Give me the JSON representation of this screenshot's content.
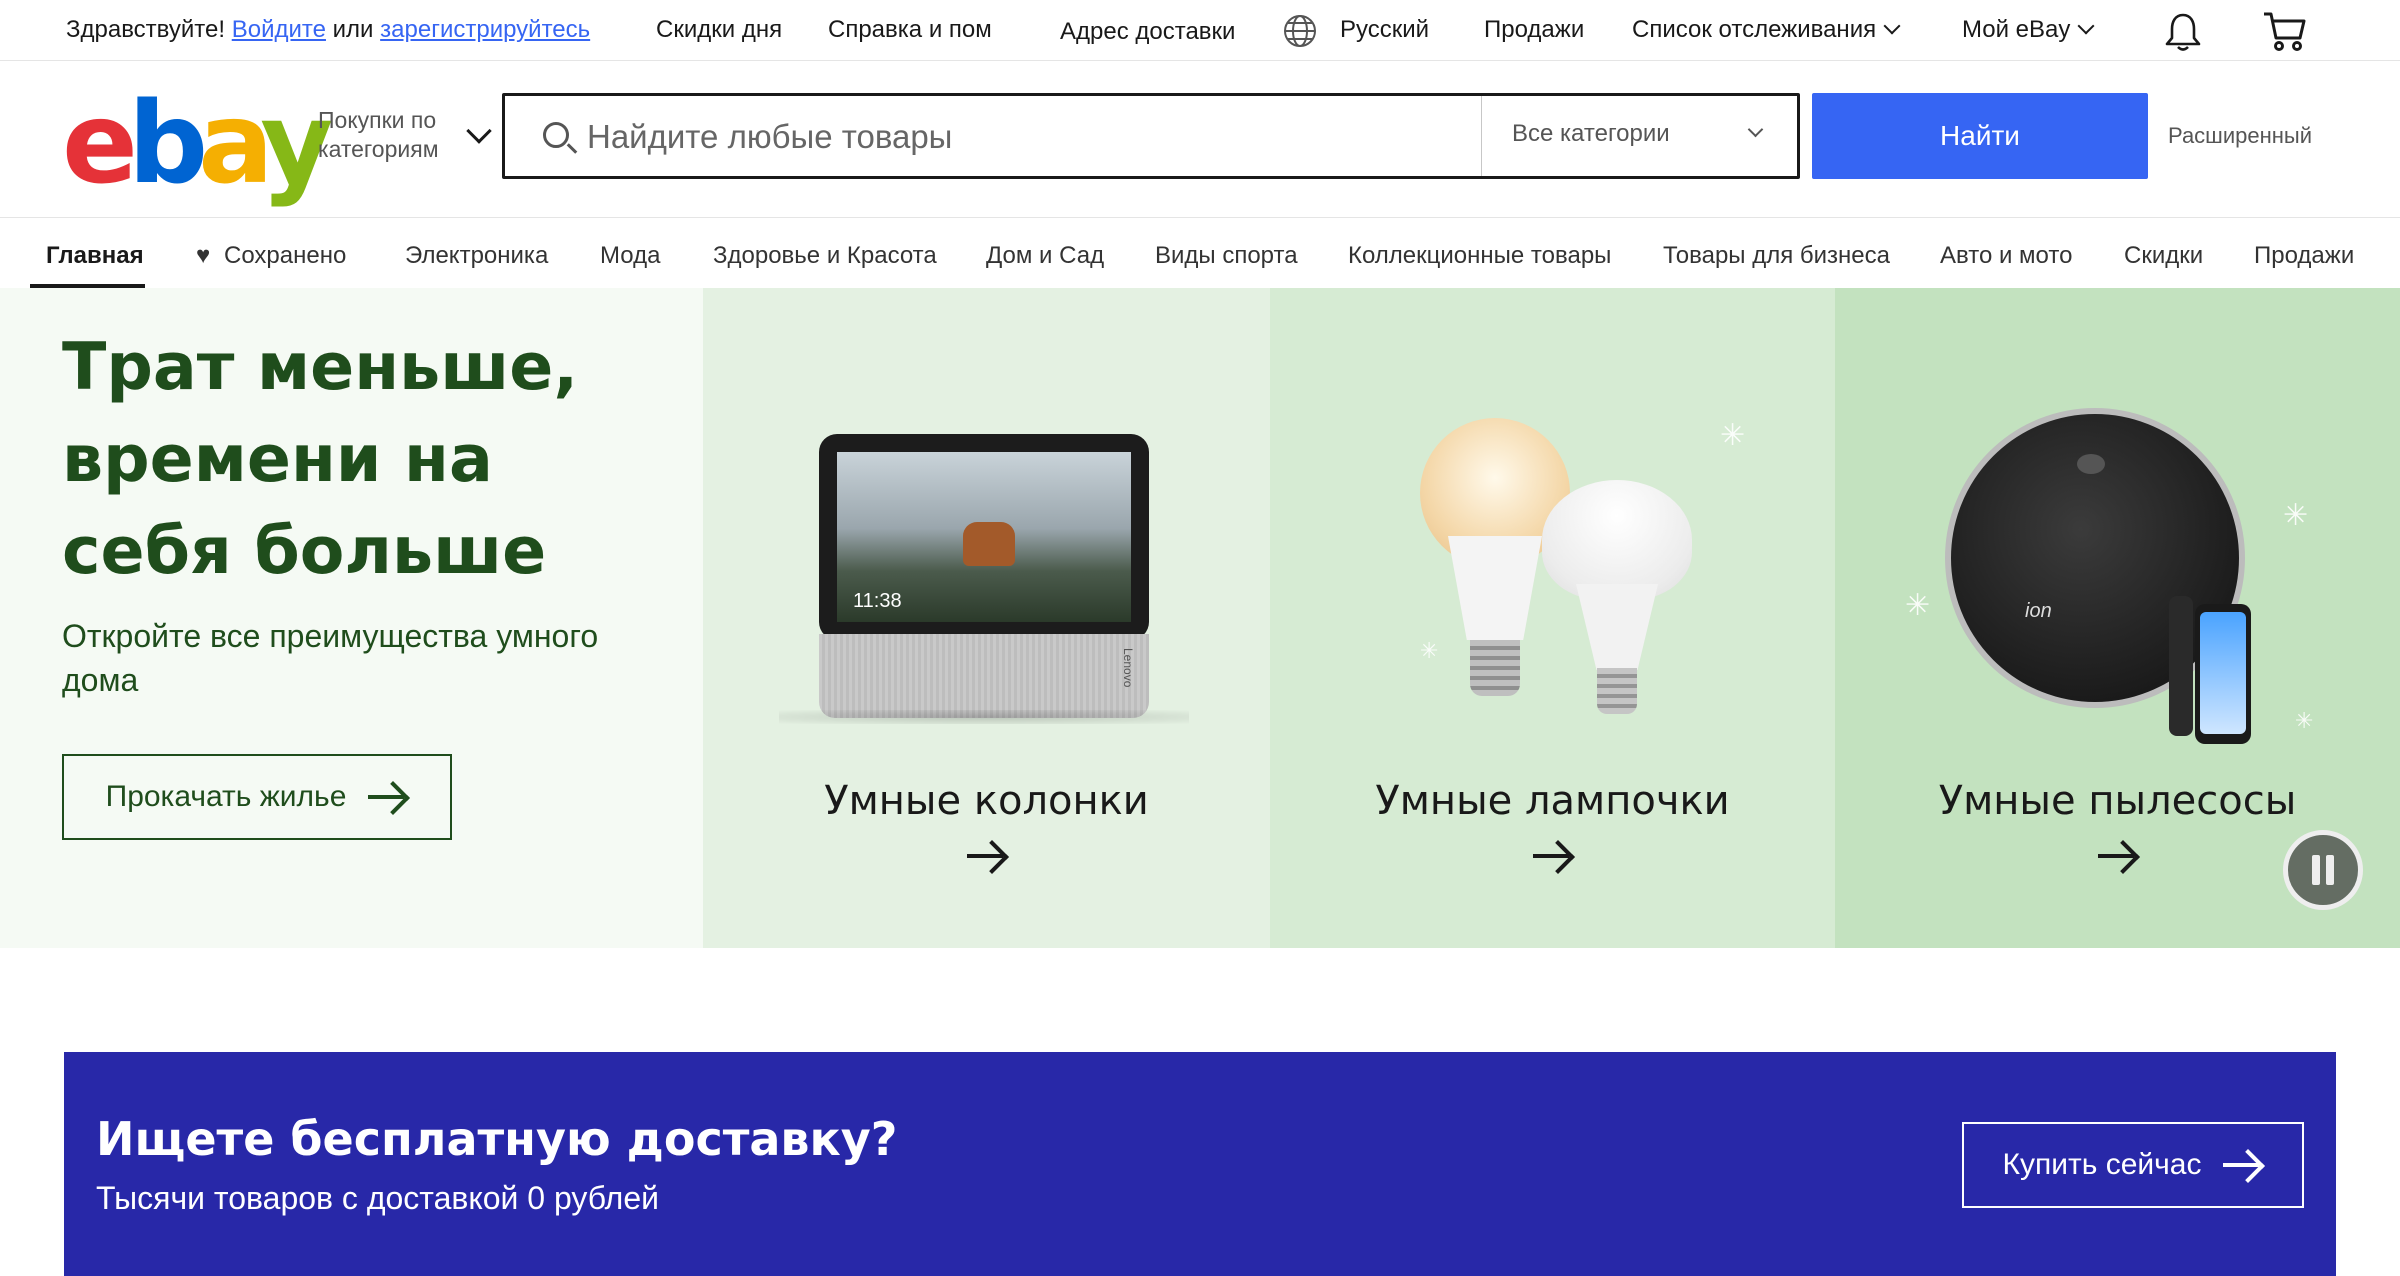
{
  "topbar": {
    "greeting": "Здравствуйте!",
    "signin_label": "Войдите",
    "or_label": "или",
    "register_label": "зарегистрируйтесь",
    "daily_deals": "Скидки дня",
    "help": "Справка и пом",
    "ship_to": "Адрес доставки",
    "language": "Русский",
    "sell": "Продажи",
    "watchlist": "Список отслеживания",
    "my_ebay": "Мой eBay"
  },
  "header": {
    "logo_letters": [
      "e",
      "b",
      "a",
      "y"
    ],
    "shop_by_category": "Покупки по категориям",
    "search_placeholder": "Найдите любые товары",
    "category_selected": "Все категории",
    "search_button": "Найти",
    "advanced": "Расширенный"
  },
  "nav": {
    "items": [
      {
        "label": "Главная",
        "active": true
      },
      {
        "label": "Сохранено"
      },
      {
        "label": "Электроника"
      },
      {
        "label": "Мода"
      },
      {
        "label": "Здоровье и Красота"
      },
      {
        "label": "Дом и Сад"
      },
      {
        "label": "Виды спорта"
      },
      {
        "label": "Коллекционные товары"
      },
      {
        "label": "Товары для бизнеса"
      },
      {
        "label": "Авто и мото"
      },
      {
        "label": "Скидки"
      },
      {
        "label": "Продажи"
      }
    ]
  },
  "hero": {
    "title": "Трат меньше, времени на себя больше",
    "subtitle": "Откройте все преимущества умного дома",
    "cta": "Прокачать жилье",
    "speaker_clock": "11:38",
    "speaker_brand": "Lenovo",
    "vacuum_brand": "ion",
    "panels": [
      {
        "label": "Умные колонки"
      },
      {
        "label": "Умные лампочки"
      },
      {
        "label": "Умные пылесосы"
      }
    ]
  },
  "promo": {
    "title": "Ищете бесплатную доставку?",
    "subtitle": "Тысячи товаров с доставкой 0 рублей",
    "cta": "Купить сейчас"
  },
  "colors": {
    "accent": "#3665f3",
    "hero_text": "#1f4d1c",
    "promo_bg": "#2828a8"
  },
  "icons": [
    "search-icon",
    "globe-icon",
    "bell-icon",
    "cart-icon",
    "heart-icon",
    "arrow-right-icon",
    "pause-icon",
    "chevron-down-icon"
  ]
}
